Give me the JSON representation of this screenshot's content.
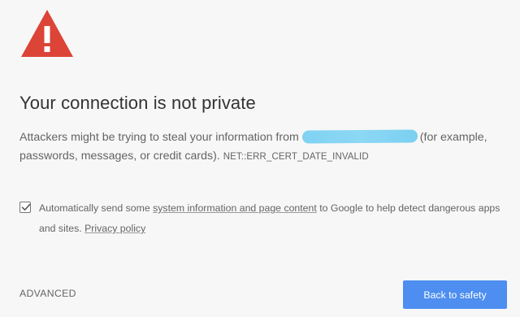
{
  "interstitial": {
    "warning_icon": "warning-triangle-icon",
    "title": "Your connection is not private",
    "message_before": "Attackers might be trying to steal your information from",
    "message_after": "(for example, passwords, messages, or credit cards).",
    "error_code": "NET::ERR_CERT_DATE_INVALID",
    "redaction_color": "#82d4f3"
  },
  "extended_reporting": {
    "checked": true,
    "text_before": "Automatically send some",
    "link_label": "system information and page content",
    "text_after": "to Google to help detect dangerous apps and sites.",
    "privacy_link_label": "Privacy policy"
  },
  "actions": {
    "advanced_label": "ADVANCED",
    "primary_label": "Back to safety"
  },
  "colors": {
    "background": "#f7f7f7",
    "warning_red": "#dc4437",
    "primary_button": "#4d8ef0",
    "title_text": "#333333",
    "body_text": "#646464"
  }
}
